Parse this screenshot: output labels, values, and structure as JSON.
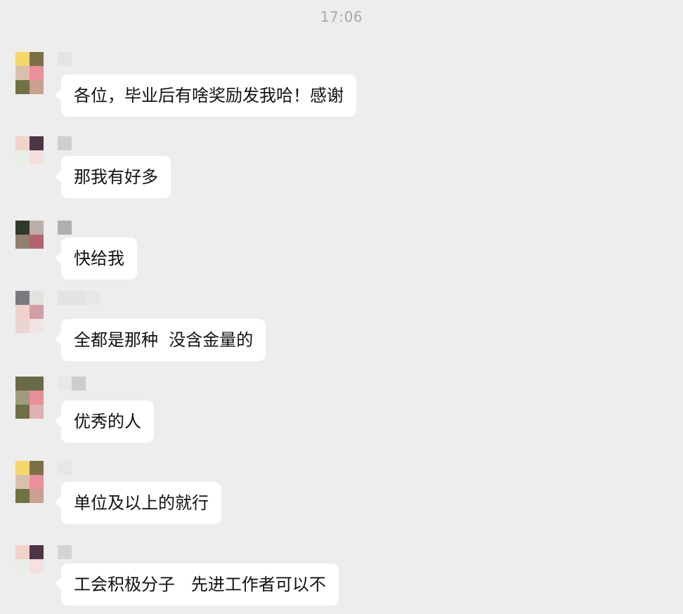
{
  "chat": {
    "timestamp": "17:06",
    "messages": [
      {
        "text": "各位，毕业后有啥奖励发我哈！感谢",
        "avatar_colors": [
          "#f7d76a",
          "#7c7046",
          "#d9c0ac",
          "#ea8f9b",
          "#6f7243",
          "#caa090"
        ],
        "name_colors": [
          "#e4e4e4"
        ]
      },
      {
        "text": "那我有好多",
        "avatar_colors": [
          "#f2d2c9",
          "#4c3546",
          "#e8efe6",
          "#f5dfdf",
          "#ededed",
          "#ededed"
        ],
        "name_colors": [
          "#cfcfcf"
        ]
      },
      {
        "text": "快给我",
        "avatar_colors": [
          "#2f3829",
          "#bcaeaa",
          "#91806f",
          "#b2646e",
          "#ededed",
          "#ededed"
        ],
        "name_colors": [
          "#b0b0b0"
        ]
      },
      {
        "text": "全都是那种  没含金量的",
        "avatar_colors": [
          "#7a7a80",
          "#e2e2df",
          "#f0d2cc",
          "#d09ea4",
          "#ead4d4",
          "#f1e4e4"
        ],
        "name_colors": [
          "#e3e3e3",
          "#e3e3e3",
          "#e7e7e7"
        ]
      },
      {
        "text": "优秀的人",
        "avatar_colors": [
          "#6c6a47",
          "#6a6a4a",
          "#9e9c7c",
          "#e68f99",
          "#6e6e47",
          "#dfb0b4"
        ],
        "name_colors": [
          "#e7e7e7",
          "#cdcdcd"
        ]
      },
      {
        "text": "单位及以上的就行",
        "avatar_colors": [
          "#f7d76a",
          "#7c7046",
          "#d9c0ac",
          "#ea8f9b",
          "#6f7243",
          "#caa090"
        ],
        "name_colors": [
          "#e6e6e6"
        ]
      },
      {
        "text": "工会积极分子   先进工作者可以不",
        "avatar_colors": [
          "#f2d2c9",
          "#4c3546",
          "#e8efe6",
          "#f5dfdf",
          "#ededed",
          "#ededed"
        ],
        "name_colors": [
          "#d4d4d4"
        ]
      }
    ]
  }
}
